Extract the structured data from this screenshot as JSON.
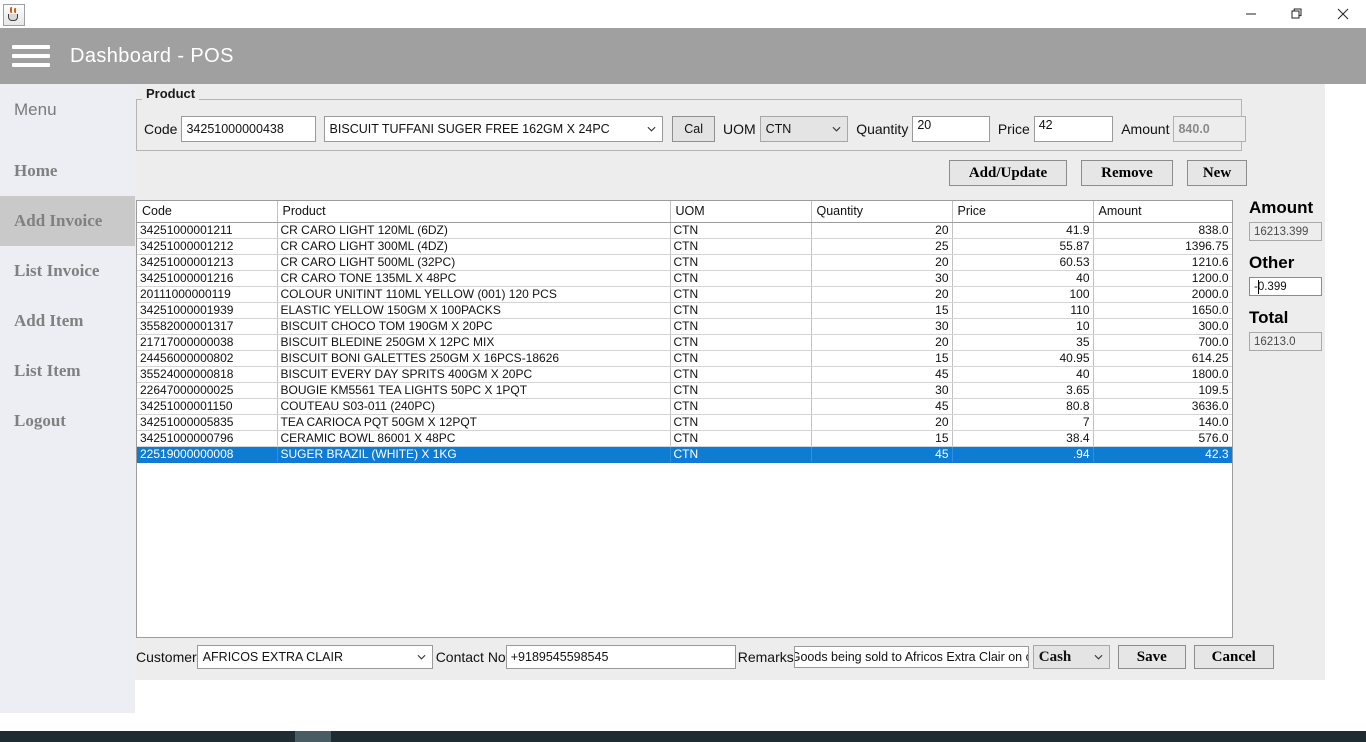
{
  "window": {
    "app_icon": "java-coffee-cup-icon",
    "controls": {
      "minimize": "minimize-icon",
      "maximize": "restore-icon",
      "close": "close-icon"
    }
  },
  "header": {
    "menu_icon": "hamburger-menu-icon",
    "title": "Dashboard - POS"
  },
  "sidebar": {
    "label": "Menu",
    "items": [
      {
        "label": "Home",
        "active": false
      },
      {
        "label": "Add Invoice",
        "active": true
      },
      {
        "label": "List Invoice",
        "active": false
      },
      {
        "label": "Add Item",
        "active": false
      },
      {
        "label": "List Item",
        "active": false
      },
      {
        "label": "Logout",
        "active": false
      }
    ]
  },
  "product_panel": {
    "legend": "Product",
    "code_label": "Code",
    "code_value": "34251000000438",
    "product_value": "BISCUIT TUFFANI SUGER FREE 162GM X 24PC",
    "cal_label": "Cal",
    "uom_label": "UOM",
    "uom_value": "CTN",
    "quantity_label": "Quantity",
    "quantity_value": "20",
    "price_label": "Price",
    "price_value": "42",
    "amount_label": "Amount",
    "amount_value": "840.0"
  },
  "actions": {
    "add_update": "Add/Update",
    "remove": "Remove",
    "new": "New"
  },
  "table": {
    "columns": [
      "Code",
      "Product",
      "UOM",
      "Quantity",
      "Price",
      "Amount"
    ],
    "rows": [
      {
        "code": "34251000001211",
        "product": "CR CARO LIGHT 120ML (6DZ)",
        "uom": "CTN",
        "qty": "20",
        "price": "41.9",
        "amount": "838.0",
        "selected": false
      },
      {
        "code": "34251000001212",
        "product": "CR CARO LIGHT 300ML (4DZ)",
        "uom": "CTN",
        "qty": "25",
        "price": "55.87",
        "amount": "1396.75",
        "selected": false
      },
      {
        "code": "34251000001213",
        "product": "CR CARO LIGHT 500ML (32PC)",
        "uom": "CTN",
        "qty": "20",
        "price": "60.53",
        "amount": "1210.6",
        "selected": false
      },
      {
        "code": "34251000001216",
        "product": "CR CARO TONE 135ML X 48PC",
        "uom": "CTN",
        "qty": "30",
        "price": "40",
        "amount": "1200.0",
        "selected": false
      },
      {
        "code": "20111000000119",
        "product": "COLOUR UNITINT 110ML YELLOW (001) 120 PCS",
        "uom": "CTN",
        "qty": "20",
        "price": "100",
        "amount": "2000.0",
        "selected": false
      },
      {
        "code": "34251000001939",
        "product": "ELASTIC YELLOW 150GM X 100PACKS",
        "uom": "CTN",
        "qty": "15",
        "price": "110",
        "amount": "1650.0",
        "selected": false
      },
      {
        "code": "35582000001317",
        "product": "BISCUIT  CHOCO TOM 190GM X 20PC",
        "uom": "CTN",
        "qty": "30",
        "price": "10",
        "amount": "300.0",
        "selected": false
      },
      {
        "code": "21717000000038",
        "product": "BISCUIT BLEDINE 250GM X 12PC MIX",
        "uom": "CTN",
        "qty": "20",
        "price": "35",
        "amount": "700.0",
        "selected": false
      },
      {
        "code": "24456000000802",
        "product": "BISCUIT BONI GALETTES 250GM X 16PCS-18626",
        "uom": "CTN",
        "qty": "15",
        "price": "40.95",
        "amount": "614.25",
        "selected": false
      },
      {
        "code": "35524000000818",
        "product": "BISCUIT EVERY DAY SPRITS 400GM X 20PC",
        "uom": "CTN",
        "qty": "45",
        "price": "40",
        "amount": "1800.0",
        "selected": false
      },
      {
        "code": "22647000000025",
        "product": "BOUGIE KM5561 TEA LIGHTS 50PC X 1PQT",
        "uom": "CTN",
        "qty": "30",
        "price": "3.65",
        "amount": "109.5",
        "selected": false
      },
      {
        "code": "34251000001150",
        "product": "COUTEAU S03-011 (240PC)",
        "uom": "CTN",
        "qty": "45",
        "price": "80.8",
        "amount": "3636.0",
        "selected": false
      },
      {
        "code": "34251000005835",
        "product": "TEA CARIOCA PQT 50GM X 12PQT",
        "uom": "CTN",
        "qty": "20",
        "price": "7",
        "amount": "140.0",
        "selected": false
      },
      {
        "code": "34251000000796",
        "product": "CERAMIC BOWL 86001 X 48PC",
        "uom": "CTN",
        "qty": "15",
        "price": "38.4",
        "amount": "576.0",
        "selected": false
      },
      {
        "code": "22519000000008",
        "product": "SUGER BRAZIL (WHITE) X 1KG",
        "uom": "CTN",
        "qty": "45",
        "price": ".94",
        "amount": "42.3",
        "selected": true
      }
    ]
  },
  "totals": {
    "amount_label": "Amount",
    "amount_value": "16213.399",
    "other_label": "Other",
    "other_value": "-0.399",
    "total_label": "Total",
    "total_value": "16213.0"
  },
  "footer": {
    "customer_label": "Customer",
    "customer_value": "AFRICOS EXTRA CLAIR",
    "contact_label": "Contact No",
    "contact_value": "+9189545598545",
    "remarks_label": "Remarks",
    "remarks_value": "Goods being sold to Africos Extra Clair on cash.",
    "payment_value": "Cash",
    "save_label": "Save",
    "cancel_label": "Cancel"
  }
}
